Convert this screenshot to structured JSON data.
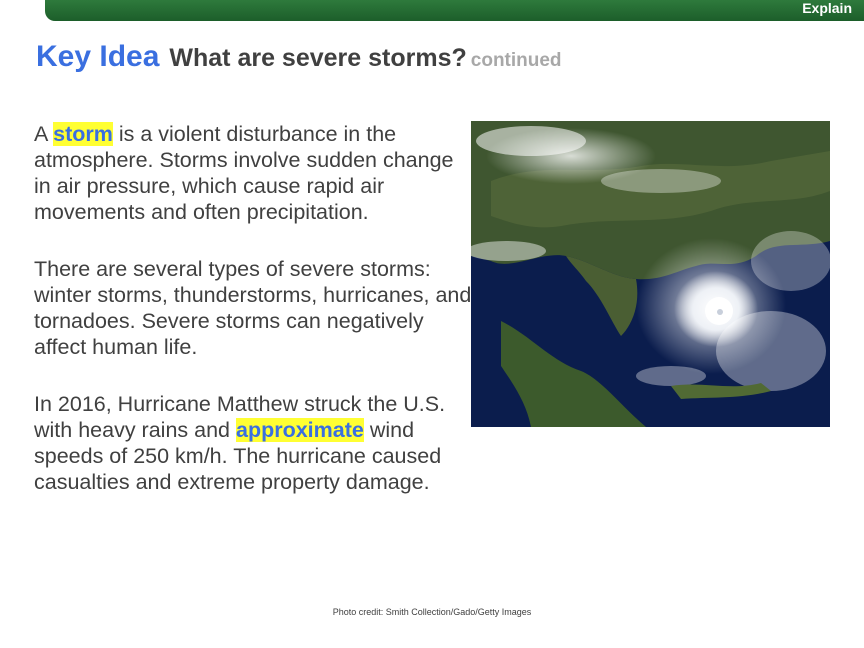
{
  "header": {
    "section_label": "Explain"
  },
  "title": {
    "key_idea": "Key Idea",
    "question": "What are severe storms?",
    "continued": "continued"
  },
  "paragraphs": {
    "p1": {
      "pre": "A ",
      "term": "storm",
      "post": " is a violent disturbance in the atmosphere. Storms involve sudden change  in air pressure, which cause rapid air movements and often precipitation."
    },
    "p2": "There are several types of severe storms: winter storms, thunderstorms, hurricanes, and tornadoes. Severe storms can negatively affect human life.",
    "p3": {
      "pre": "In 2016, Hurricane Matthew struck the U.S. with heavy rains and ",
      "term": "approximate",
      "post": " wind speeds of 250 km/h. The hurricane caused casualties and extreme property damage."
    }
  },
  "image": {
    "subject": "satellite image of Hurricane Matthew over the southeastern United States"
  },
  "credit": "Photo credit: Smith Collection/Gado/Getty Images"
}
